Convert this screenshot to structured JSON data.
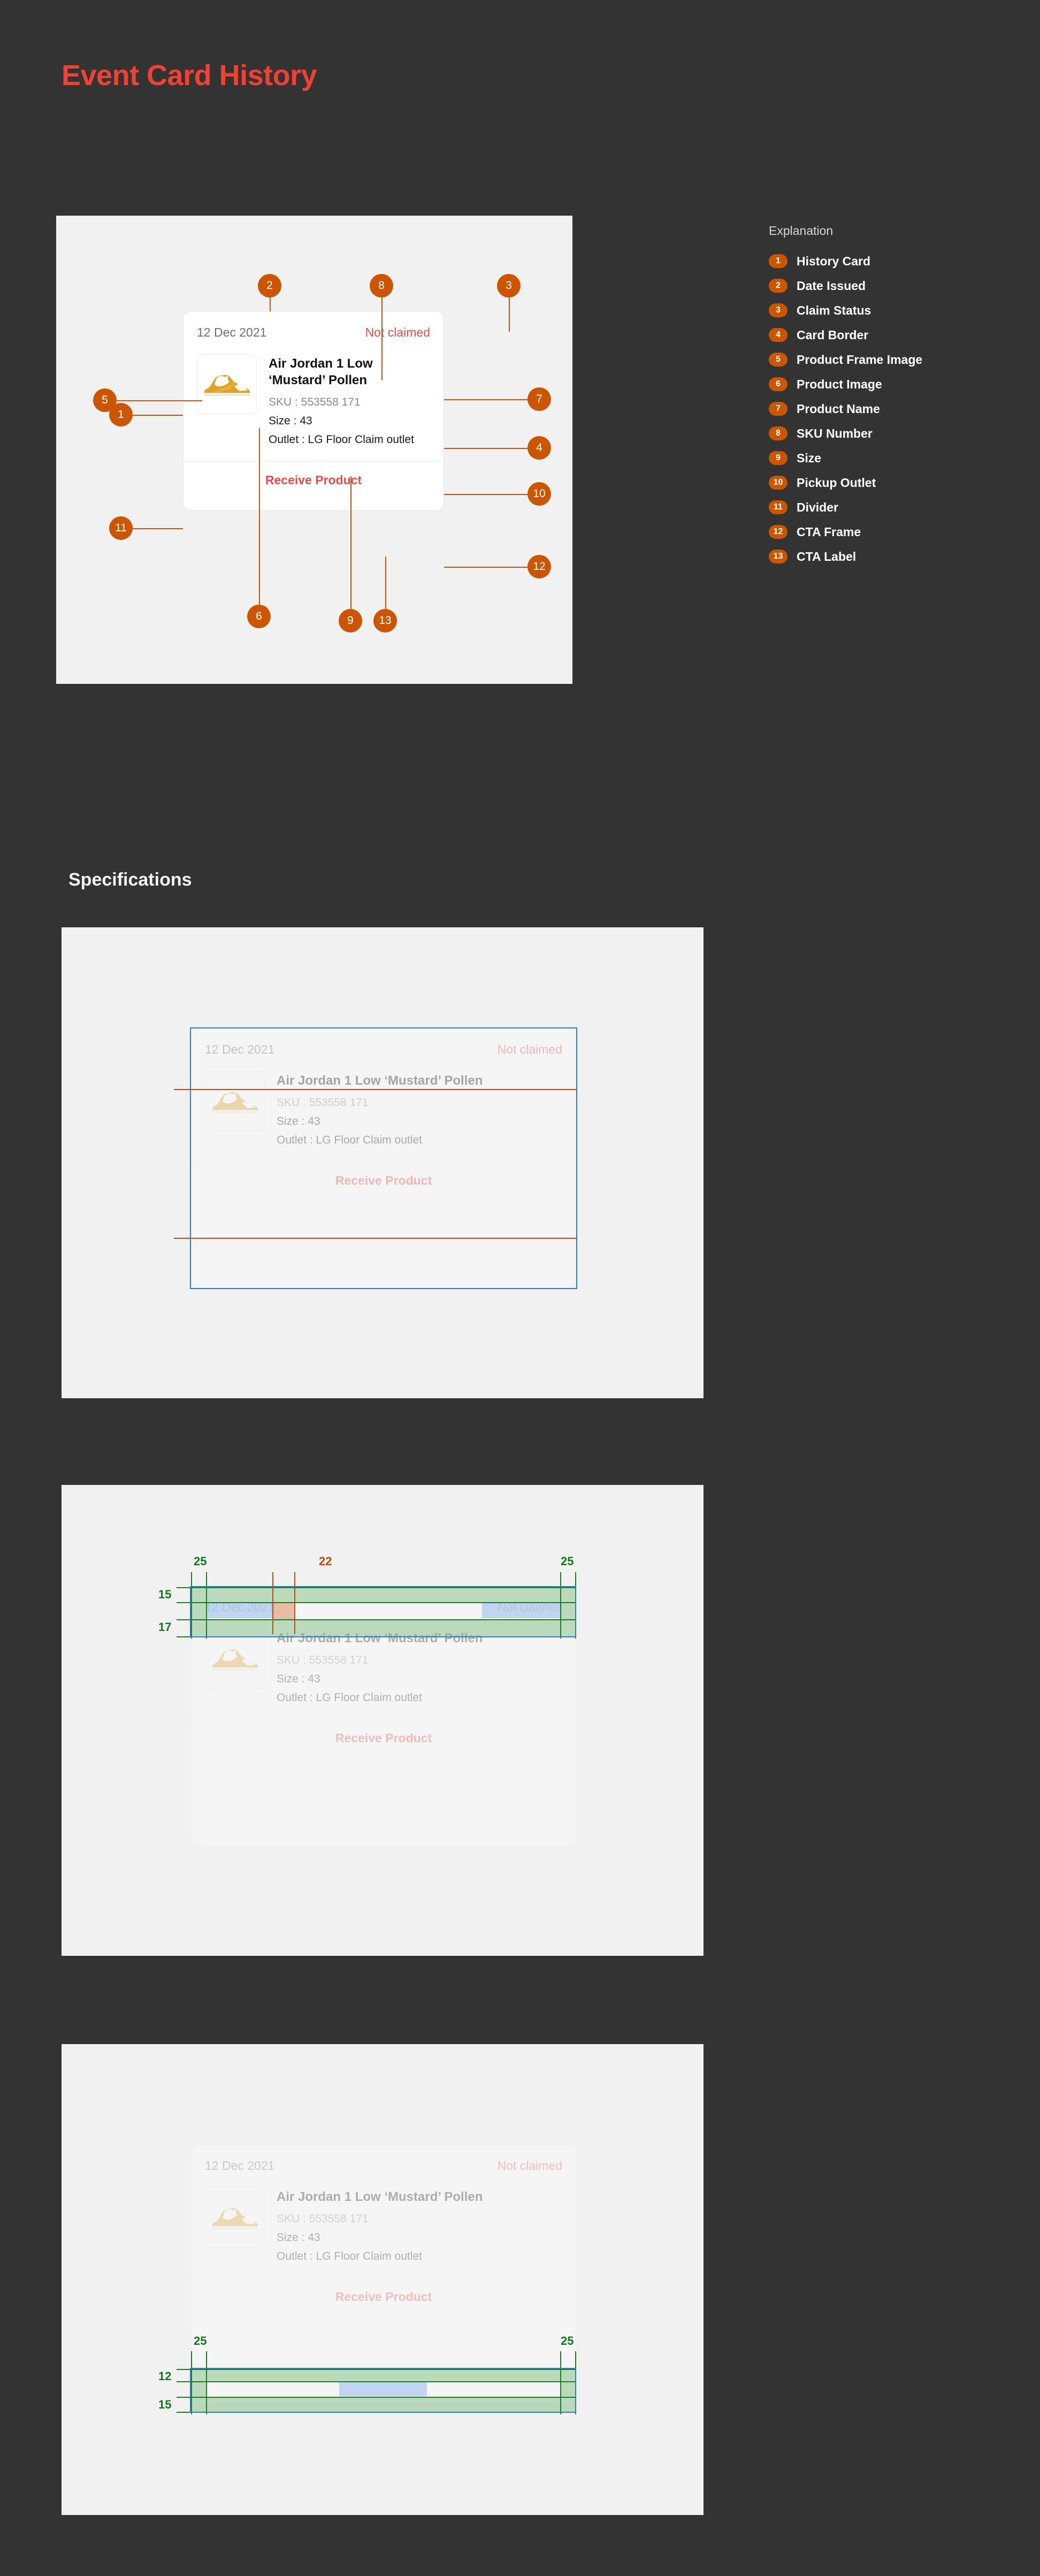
{
  "doc": {
    "title": "Event Card History",
    "specifications_heading": "Specifications"
  },
  "card": {
    "date": "12 Dec 2021",
    "status": "Not claimed",
    "product_name": "Air Jordan 1 Low ‘Mustard’ Pollen",
    "sku": "SKU : 553558 171",
    "size": "Size : 43",
    "outlet": "Outlet : LG Floor Claim outlet",
    "cta_label": "Receive Product"
  },
  "legend": {
    "title": "Explanation",
    "items": [
      {
        "num": "1",
        "label": "History Card"
      },
      {
        "num": "2",
        "label": "Date Issued"
      },
      {
        "num": "3",
        "label": "Claim Status"
      },
      {
        "num": "4",
        "label": "Card Border"
      },
      {
        "num": "5",
        "label": "Product Frame Image"
      },
      {
        "num": "6",
        "label": "Product Image"
      },
      {
        "num": "7",
        "label": "Product Name"
      },
      {
        "num": "8",
        "label": "SKU Number"
      },
      {
        "num": "9",
        "label": "Size"
      },
      {
        "num": "10",
        "label": "Pickup Outlet"
      },
      {
        "num": "11",
        "label": "Divider"
      },
      {
        "num": "12",
        "label": "CTA Frame"
      },
      {
        "num": "13",
        "label": "CTA Label"
      }
    ]
  },
  "callouts": [
    {
      "num": "2"
    },
    {
      "num": "8"
    },
    {
      "num": "3"
    },
    {
      "num": "5"
    },
    {
      "num": "1"
    },
    {
      "num": "11"
    },
    {
      "num": "7"
    },
    {
      "num": "4"
    },
    {
      "num": "10"
    },
    {
      "num": "12"
    },
    {
      "num": "6"
    },
    {
      "num": "9"
    },
    {
      "num": "13"
    }
  ],
  "measurements": {
    "header_row": {
      "pad_left": "25",
      "gap": "22",
      "pad_right": "25",
      "pad_top": "15",
      "pad_bottom": "17"
    },
    "cta_row": {
      "pad_left": "25",
      "pad_right": "25",
      "pad_top": "12",
      "pad_bottom": "15"
    }
  },
  "colors": {
    "background": "#333333",
    "title_red": "#EF4136",
    "panel": "#F1F1F1",
    "marker_orange": "#CC5500",
    "status_red": "#E84A4A",
    "selection_blue": "#2B7CD3",
    "measure_green": "#14761D",
    "gap_orange": "#C0490F"
  }
}
